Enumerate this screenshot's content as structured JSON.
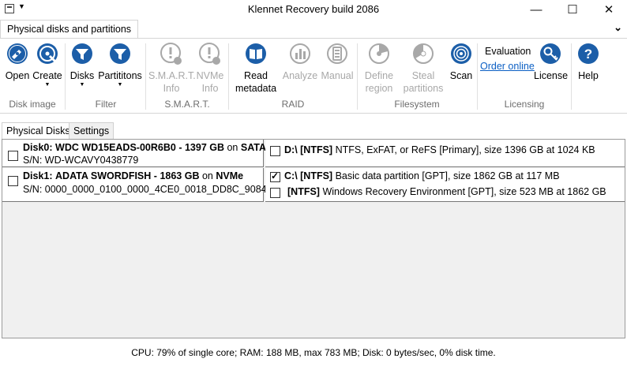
{
  "window": {
    "title": "Klennet Recovery build 2086",
    "minimize": "—",
    "maximize": "☐",
    "close": "✕"
  },
  "ribbon": {
    "tab": "Physical disks and partitions",
    "collapse": "⌄",
    "groups": {
      "disk_image": "Disk image",
      "filter": "Filter",
      "smart": "S.M.A.R.T.",
      "raid": "RAID",
      "filesystem": "Filesystem",
      "licensing": "Licensing"
    },
    "buttons": {
      "open": "Open",
      "create": "Create",
      "disks": "Disks",
      "partitions": "Partititons",
      "smart_info_1": "S.M.A.R.T.",
      "smart_info_2": "Info",
      "nvme_info_1": "NVMe",
      "nvme_info_2": "Info",
      "read_metadata_1": "Read",
      "read_metadata_2": "metadata",
      "analyze": "Analyze",
      "manual": "Manual",
      "define_region_1": "Define",
      "define_region_2": "region",
      "steal_partitions_1": "Steal",
      "steal_partitions_2": "partitions",
      "scan": "Scan",
      "evaluation": "Evaluation",
      "order_online": "Order online",
      "license": "License",
      "help": "Help"
    }
  },
  "content_tabs": [
    "Physical Disks",
    "Settings"
  ],
  "disks": [
    {
      "name": "Disk0:",
      "model": "WDC WD15EADS-00R6B0",
      "sep": "-",
      "size": "1397 GB",
      "on": "on",
      "bus": "SATA",
      "serial": "S/N: WD-WCAVY0438779",
      "checked": false
    },
    {
      "name": "Disk1:",
      "model": "ADATA SWORDFISH",
      "sep": "-",
      "size": "1863 GB",
      "on": "on",
      "bus": "NVMe",
      "serial": "S/N: 0000_0000_0100_0000_4CE0_0018_DD8C_9084.",
      "checked": false
    }
  ],
  "partitions": [
    {
      "label": "D:\\ [NTFS]",
      "desc": "NTFS, ExFAT, or ReFS [Primary], size 1396 GB at 1024 KB",
      "checked": false
    },
    {
      "label": "C:\\ [NTFS]",
      "desc": "Basic data partition [GPT], size 1862 GB at 117 MB",
      "checked": true
    },
    {
      "label": "[NTFS]",
      "desc": "Windows Recovery Environment [GPT], size 523 MB at 1862 GB",
      "checked": false
    }
  ],
  "status": "CPU: 79% of single core; RAM: 188 MB, max 783 MB; Disk: 0 bytes/sec, 0% disk time.",
  "colors": {
    "icon_blue": "#1c5ea8",
    "icon_gray": "#a8a8a8",
    "link": "#0b5fc4"
  }
}
